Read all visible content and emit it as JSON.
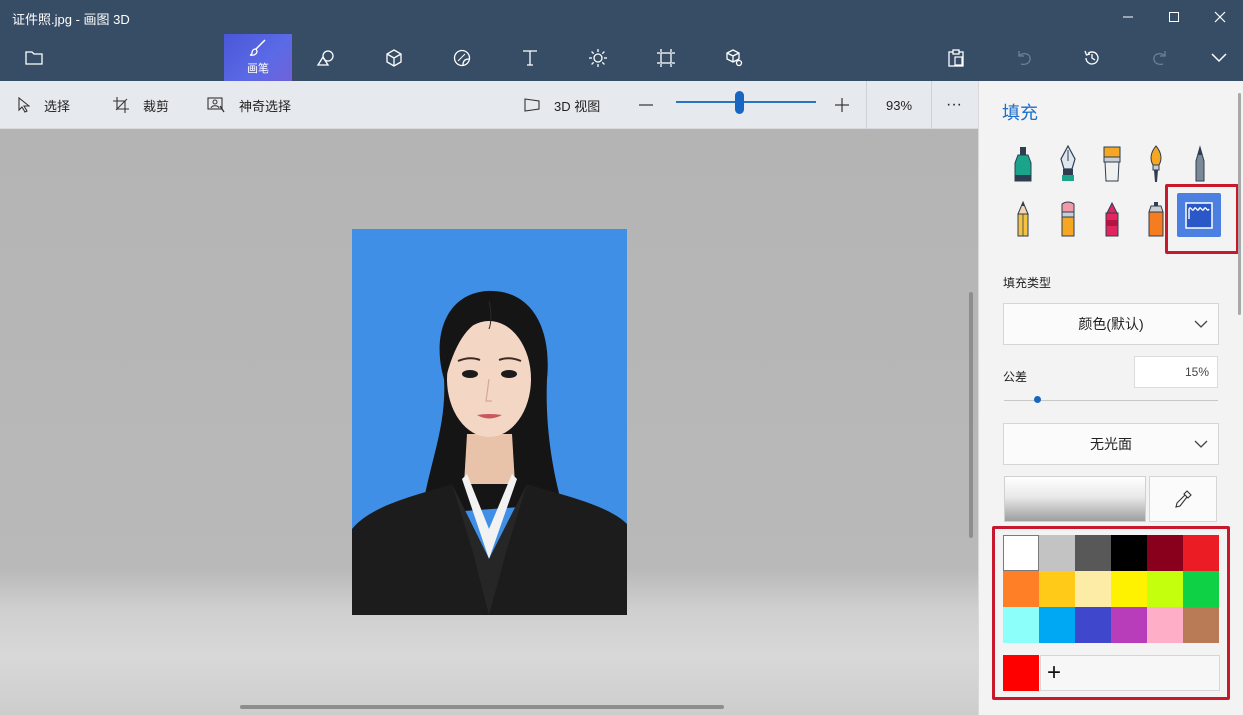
{
  "window": {
    "title": "证件照.jpg - 画图 3D"
  },
  "colors": {
    "titlebar": "#374d66",
    "accent": "#1d6fc8",
    "highlight_box": "#c8192c",
    "photo_background": "#3f8fe6"
  },
  "maintoolbar": {
    "active_label": "画笔",
    "icons": [
      "folder-icon",
      "brush-icon",
      "2d-shapes-icon",
      "3d-shapes-icon",
      "stickers-icon",
      "text-icon",
      "effects-icon",
      "canvas-icon",
      "3d-library-icon",
      "paste-icon",
      "undo-icon",
      "history-icon",
      "redo-icon",
      "expand-icon"
    ]
  },
  "subtoolbar": {
    "select": "选择",
    "crop": "裁剪",
    "magic_select": "神奇选择",
    "view_3d": "3D 视图",
    "zoom_level": 0.93,
    "zoom_pct": "93%",
    "more": "···"
  },
  "panel": {
    "title": "填充",
    "brushes": [
      "marker",
      "calligraphy-pen",
      "oil-brush",
      "watercolor",
      "pixel-pen",
      "pencil",
      "eraser",
      "crayon",
      "spray-can",
      "fill"
    ],
    "selected_brush": "fill",
    "fill_type_label": "填充类型",
    "fill_type_value": "颜色(默认)",
    "tolerance_label": "公差",
    "tolerance_value": "15%",
    "tolerance_level": 0.15,
    "finish_value": "无光面",
    "palette": [
      "#ffffff",
      "#c3c3c3",
      "#585858",
      "#000000",
      "#88001b",
      "#ec1c24",
      "#ff7f27",
      "#ffca18",
      "#fdeca6",
      "#fff200",
      "#c4ff0e",
      "#0ed145",
      "#8cfffb",
      "#00a8f3",
      "#3f48cc",
      "#b83dba",
      "#ffaec8",
      "#b97a56"
    ],
    "current_color": "#ff0000",
    "add_symbol": "+"
  }
}
